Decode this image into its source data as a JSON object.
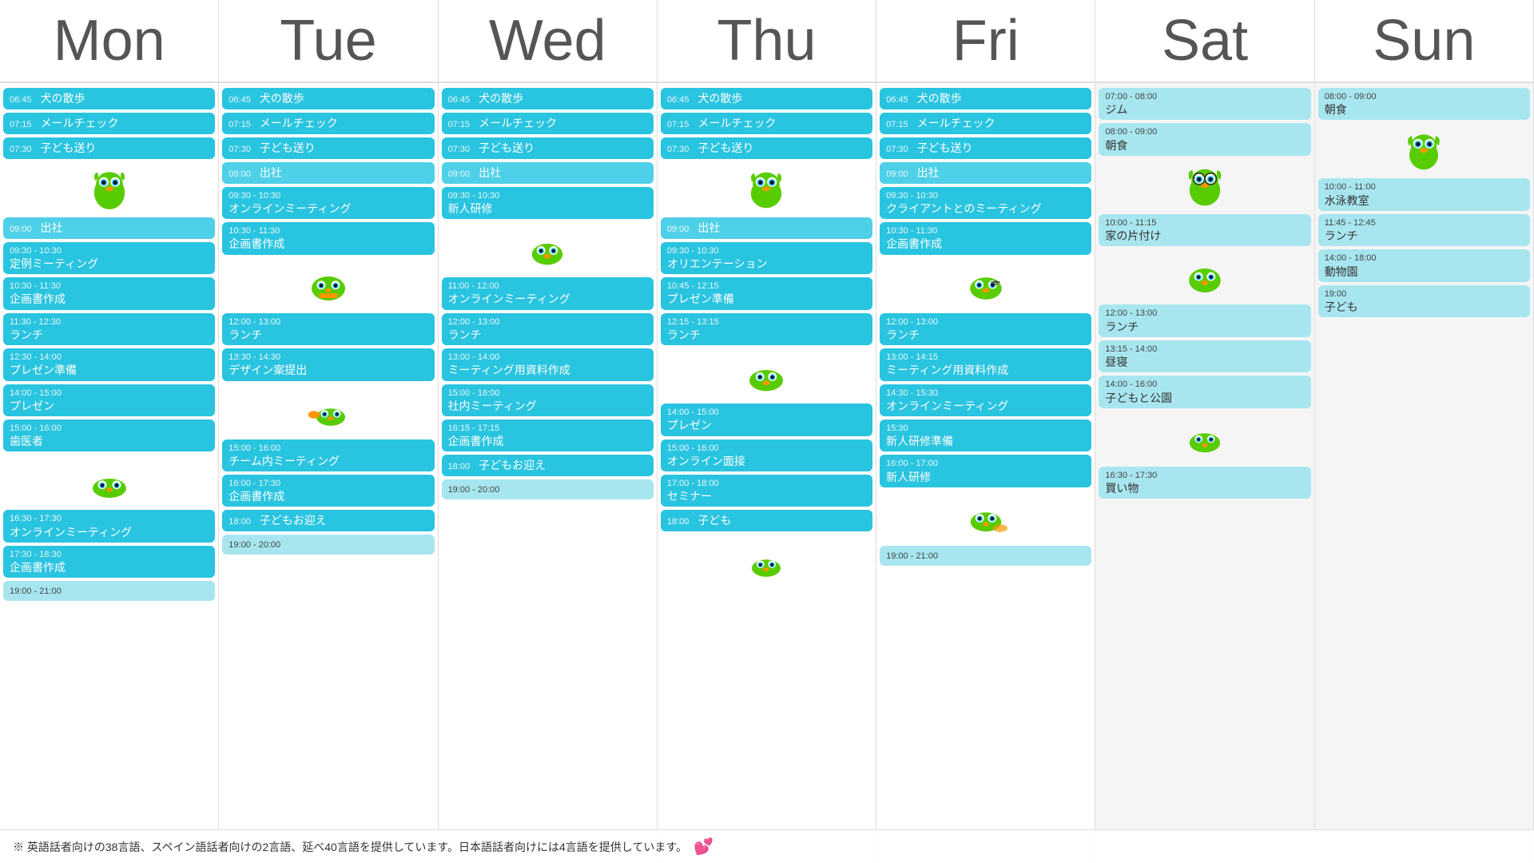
{
  "headers": [
    "Mon",
    "Tue",
    "Wed",
    "Thu",
    "Fri",
    "Sat",
    "Sun"
  ],
  "notice": "※ 英語話者向けの38言語、スペイン語話者向けの2言語、延べ40言語を提供しています。日本語話者向けには4言語を提供しています。",
  "days": {
    "mon": [
      {
        "time": "06:45",
        "title": "犬の散歩"
      },
      {
        "time": "07:15",
        "title": "メールチェック"
      },
      {
        "time": "07:30",
        "title": "子ども送り"
      },
      {
        "type": "owl"
      },
      {
        "time": "09:00",
        "title": "出社"
      },
      {
        "time": "09:30 - 10:30",
        "title": "定例ミーティング"
      },
      {
        "time": "10:30 - 11:30",
        "title": "企画書作成"
      },
      {
        "time": "11:30 - 12:30",
        "title": "ランチ"
      },
      {
        "time": "12:30 - 14:00",
        "title": "プレゼン準備"
      },
      {
        "time": "14:00 - 15:00",
        "title": "プレゼン"
      },
      {
        "time": "15:00 - 16:00",
        "title": "歯医者"
      },
      {
        "type": "owl"
      },
      {
        "time": "16:30 - 17:30",
        "title": "オンラインミーティング"
      },
      {
        "time": "17:30 - 18:30",
        "title": "企画書作成"
      },
      {
        "time": "19:00 - 21:00",
        "title": ""
      }
    ],
    "tue": [
      {
        "time": "06:45",
        "title": "犬の散歩"
      },
      {
        "time": "07:15",
        "title": "メールチェック"
      },
      {
        "time": "07:30",
        "title": "子ども送り"
      },
      {
        "time": "09:00",
        "title": "出社"
      },
      {
        "time": "09:30 - 10:30",
        "title": "オンラインミーティング"
      },
      {
        "time": "10:30 - 11:30",
        "title": "企画書作成"
      },
      {
        "type": "owl"
      },
      {
        "time": "12:00 - 13:00",
        "title": "ランチ"
      },
      {
        "time": "13:30 - 14:30",
        "title": "デザイン案提出"
      },
      {
        "type": "owl"
      },
      {
        "time": "15:00 - 16:00",
        "title": "チーム内ミーティング"
      },
      {
        "time": "16:00 - 17:30",
        "title": "企画書作成"
      },
      {
        "time": "18:00",
        "title": "子どもお迎え"
      },
      {
        "time": "19:00 - 20:00",
        "title": ""
      }
    ],
    "wed": [
      {
        "time": "06:45",
        "title": "犬の散歩"
      },
      {
        "time": "07:15",
        "title": "メールチェック"
      },
      {
        "time": "07:30",
        "title": "子ども送り"
      },
      {
        "time": "09:00",
        "title": "出社"
      },
      {
        "time": "09:30 - 10:30",
        "title": "新人研修"
      },
      {
        "type": "owl"
      },
      {
        "time": "11:00 - 12:00",
        "title": "オンラインミーティング"
      },
      {
        "time": "12:00 - 13:00",
        "title": "ランチ"
      },
      {
        "time": "13:00 - 14:00",
        "title": "ミーティング用資料作成"
      },
      {
        "time": "15:00 - 16:00",
        "title": "社内ミーティング"
      },
      {
        "time": "16:15 - 17:15",
        "title": "企画書作成"
      },
      {
        "time": "18:00",
        "title": "子どもお迎え"
      },
      {
        "time": "19:00 - 20:00",
        "title": ""
      }
    ],
    "thu": [
      {
        "time": "06:45",
        "title": "犬の散歩"
      },
      {
        "time": "07:15",
        "title": "メールチェック"
      },
      {
        "time": "07:30",
        "title": "子ども送り"
      },
      {
        "type": "owl"
      },
      {
        "time": "09:00",
        "title": "出社"
      },
      {
        "time": "09:30 - 10:30",
        "title": "オリエンテーション"
      },
      {
        "time": "10:45 - 12:15",
        "title": "プレゼン準備"
      },
      {
        "time": "12:15 - 13:15",
        "title": "ランチ"
      },
      {
        "type": "owl"
      },
      {
        "time": "14:00 - 15:00",
        "title": "プレゼン"
      },
      {
        "time": "15:00 - 16:00",
        "title": "オンライン面接"
      },
      {
        "time": "17:00 - 18:00",
        "title": "セミナー"
      },
      {
        "time": "18:00",
        "title": "子ども"
      },
      {
        "type": "owl"
      }
    ],
    "fri": [
      {
        "time": "06:45",
        "title": "犬の散歩"
      },
      {
        "time": "07:15",
        "title": "メールチェック"
      },
      {
        "time": "07:30",
        "title": "子ども送り"
      },
      {
        "time": "09:00",
        "title": "出社"
      },
      {
        "time": "09:30 - 10:30",
        "title": "クライアントとのミーティング"
      },
      {
        "time": "10:30 - 11:30",
        "title": "企画書作成"
      },
      {
        "type": "owl"
      },
      {
        "time": "12:00 - 13:00",
        "title": "ランチ"
      },
      {
        "time": "13:00 - 14:15",
        "title": "ミーティング用資料作成"
      },
      {
        "time": "14:30 - 15:30",
        "title": "オンラインミーティング"
      },
      {
        "time": "15:30",
        "title": "新人研修準備"
      },
      {
        "time": "16:00 - 17:00",
        "title": "新人研修"
      },
      {
        "type": "owl"
      },
      {
        "time": "19:00 - 21:00",
        "title": ""
      }
    ],
    "sat": [
      {
        "time": "07:00 - 08:00",
        "title": "ジム"
      },
      {
        "time": "08:00 - 09:00",
        "title": "朝食"
      },
      {
        "type": "owl"
      },
      {
        "time": "10:00 - 11:15",
        "title": "家の片付け"
      },
      {
        "type": "owl"
      },
      {
        "time": "12:00 - 13:00",
        "title": "ランチ"
      },
      {
        "time": "13:15 - 14:00",
        "title": "昼寝"
      },
      {
        "time": "14:00 - 16:00",
        "title": "子どもと公園"
      },
      {
        "type": "owl"
      },
      {
        "time": "16:30 - 17:30",
        "title": "買い物"
      }
    ],
    "sun": [
      {
        "time": "08:00 - 09:00",
        "title": "朝食"
      },
      {
        "type": "owl"
      },
      {
        "time": "10:00 - 11:00",
        "title": "水泳教室"
      },
      {
        "time": "11:45 - 12:45",
        "title": "ランチ"
      },
      {
        "time": "14:00 - 18:00",
        "title": "動物園"
      },
      {
        "time": "19:00",
        "title": "子ども"
      }
    ]
  }
}
